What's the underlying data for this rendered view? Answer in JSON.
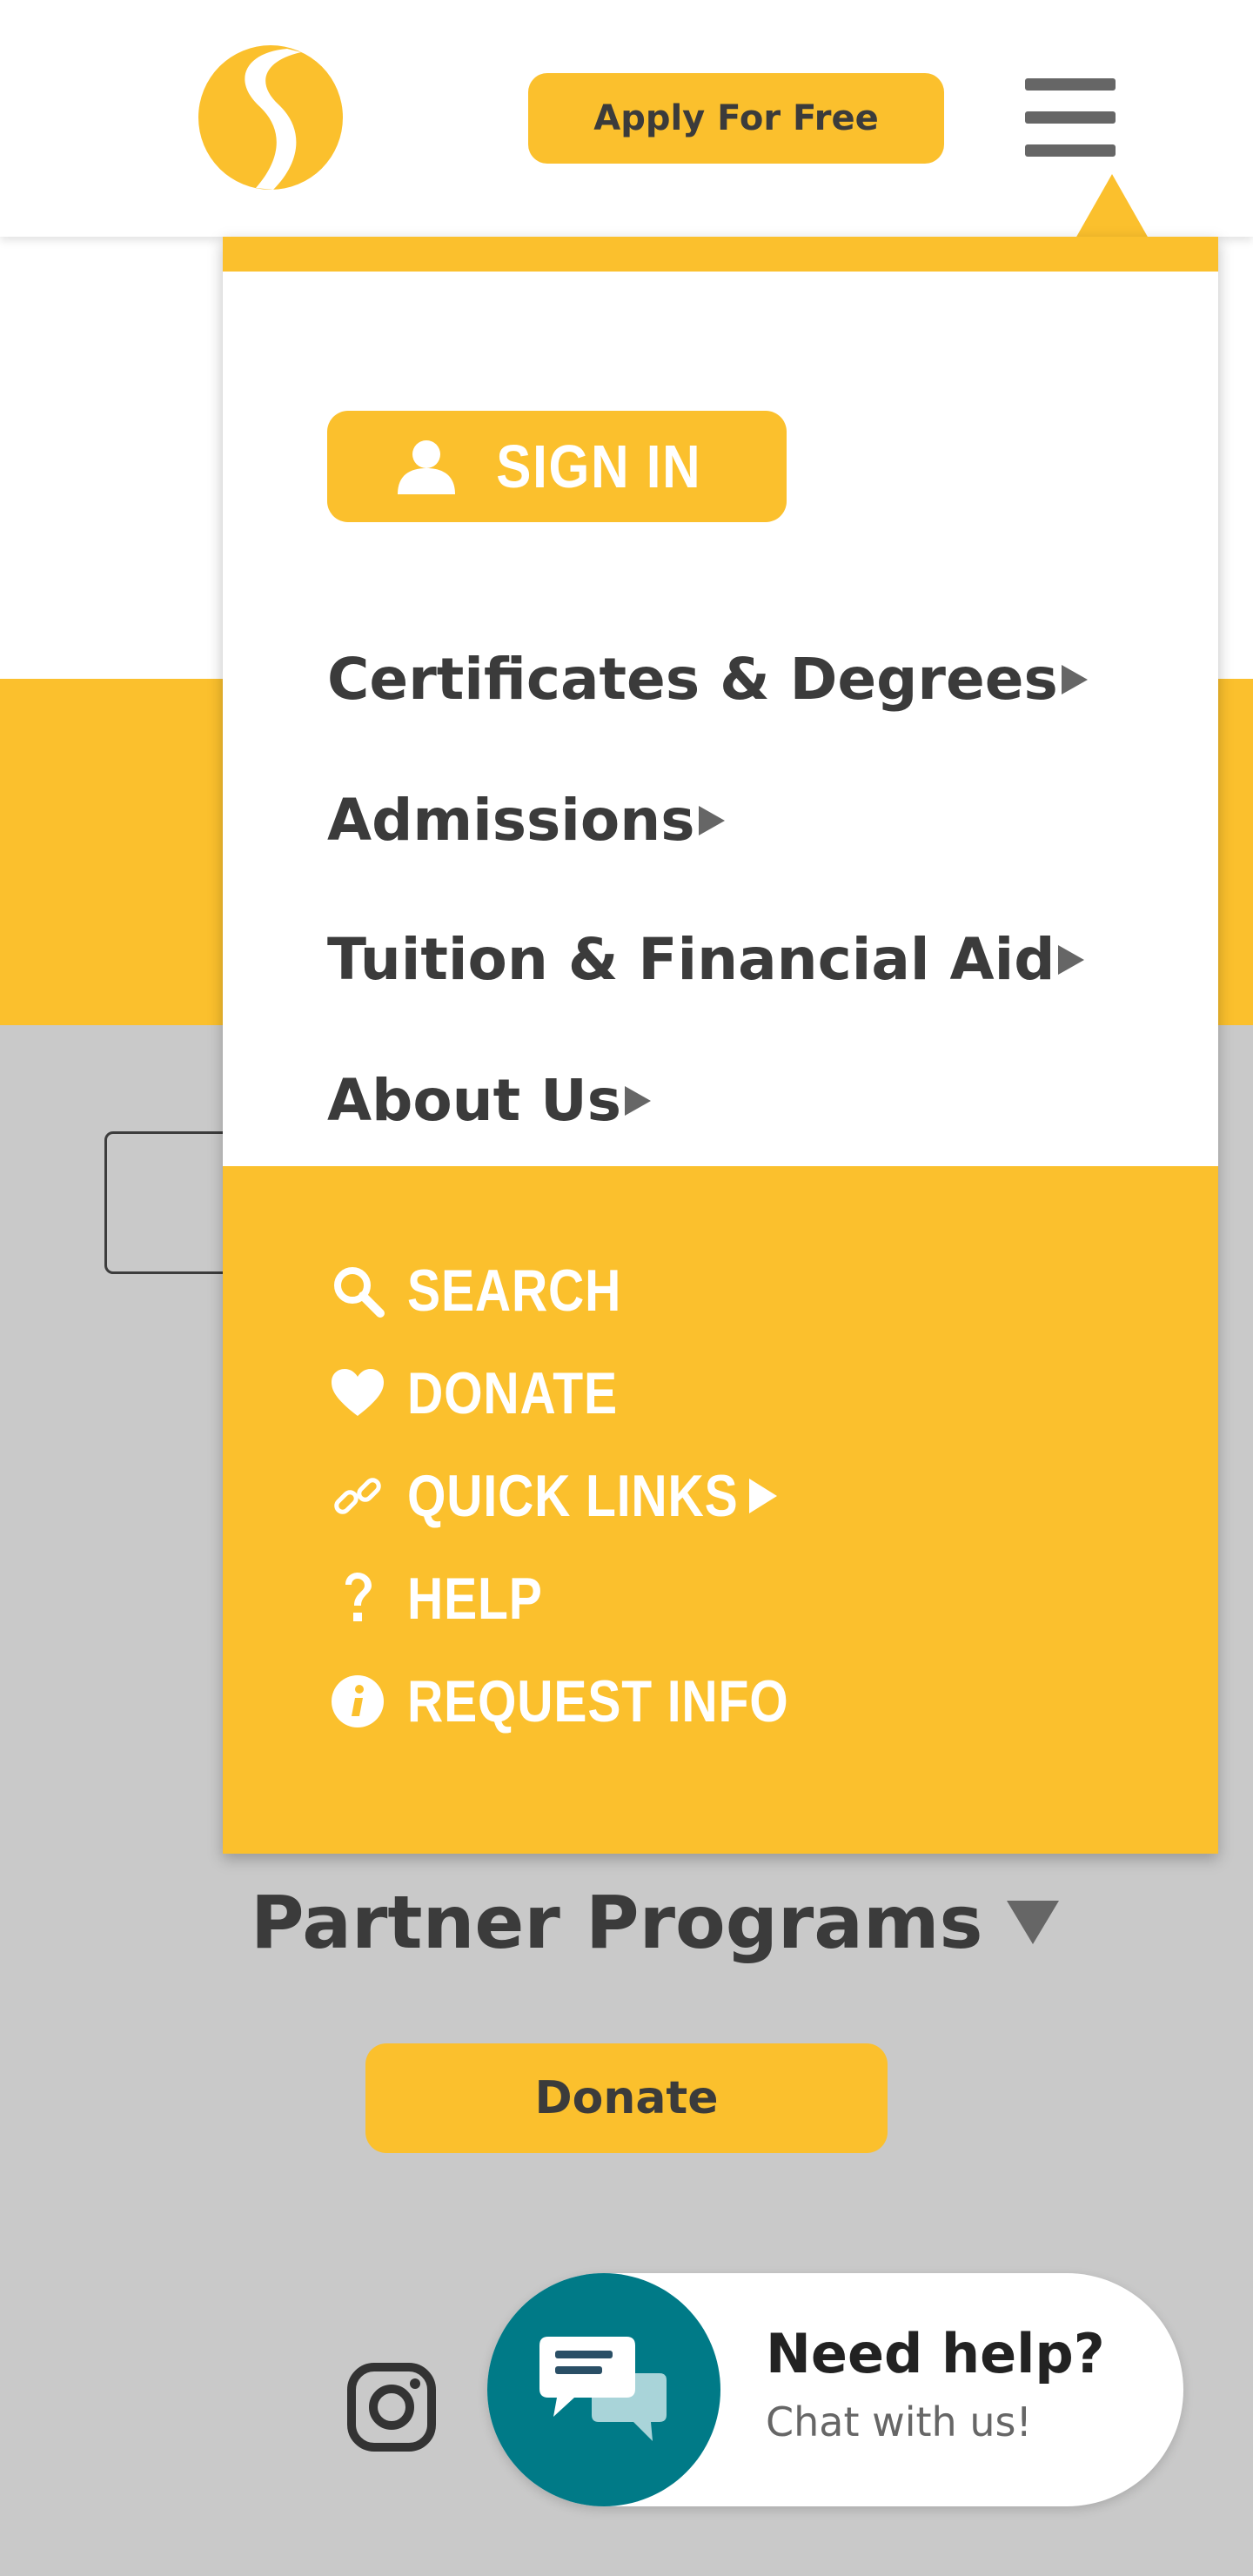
{
  "header": {
    "apply_label": "Apply For Free",
    "logo_icon": "college-s-logo",
    "menu_icon": "hamburger-icon"
  },
  "menu": {
    "sign_in_label": "SIGN IN",
    "nav_items": [
      {
        "label": "Certificates & Degrees",
        "icon": "triangle-right-icon"
      },
      {
        "label": "Admissions",
        "icon": "triangle-right-icon"
      },
      {
        "label": "Tuition & Financial Aid",
        "icon": "triangle-right-icon"
      },
      {
        "label": "About Us",
        "icon": "triangle-right-icon"
      }
    ],
    "utility_items": [
      {
        "label": "SEARCH",
        "icon": "search-icon"
      },
      {
        "label": "DONATE",
        "icon": "heart-icon"
      },
      {
        "label": "QUICK LINKS",
        "icon": "link-icon"
      },
      {
        "label": "HELP",
        "icon": "question-icon"
      },
      {
        "label": "REQUEST INFO",
        "icon": "info-icon"
      }
    ]
  },
  "page": {
    "partner_label": "Partner Programs",
    "donate_label": "Donate"
  },
  "chat": {
    "title": "Need help?",
    "subtitle": "Chat with us!"
  },
  "colors": {
    "accent": "#fbc02d",
    "text": "#3b3b3b",
    "chat": "#007a87",
    "background": "#c9c9c9"
  }
}
